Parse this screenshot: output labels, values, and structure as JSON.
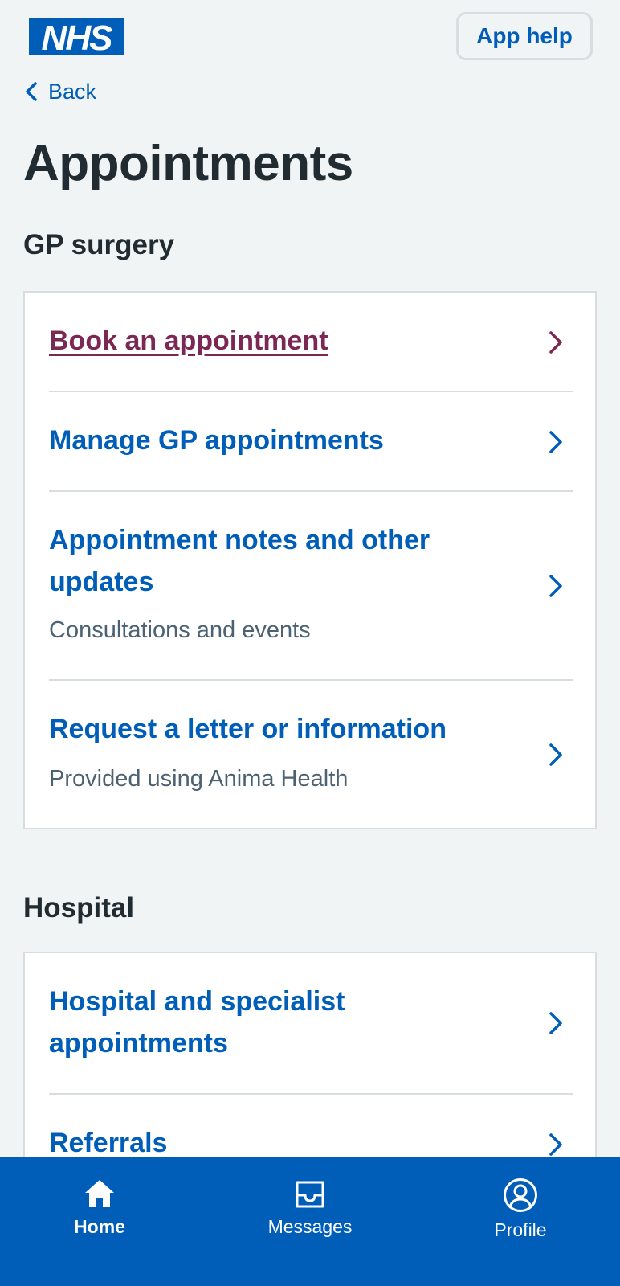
{
  "header": {
    "logo_text": "NHS",
    "app_help_label": "App help",
    "back_label": "Back"
  },
  "page_title": "Appointments",
  "sections": {
    "gp": {
      "title": "GP surgery",
      "items": [
        {
          "title": "Book an appointment",
          "subtitle": "",
          "visited": true
        },
        {
          "title": "Manage GP appointments",
          "subtitle": ""
        },
        {
          "title": "Appointment notes and other updates",
          "subtitle": "Consultations and events"
        },
        {
          "title": "Request a letter or information",
          "subtitle": "Provided using Anima Health"
        }
      ]
    },
    "hospital": {
      "title": "Hospital",
      "items": [
        {
          "title": "Hospital and specialist appointments",
          "subtitle": ""
        },
        {
          "title": "Referrals",
          "subtitle": ""
        }
      ]
    }
  },
  "nav": {
    "items": [
      {
        "label": "Home",
        "icon": "home-icon",
        "active": true
      },
      {
        "label": "Messages",
        "icon": "inbox-icon",
        "active": false
      },
      {
        "label": "Profile",
        "icon": "profile-icon",
        "active": false
      }
    ]
  },
  "colors": {
    "nhs_blue": "#005eb8",
    "visited_link": "#7c2855",
    "background": "#f0f4f5",
    "text": "#212b32",
    "secondary_text": "#4c6272",
    "border": "#d8dde0"
  }
}
